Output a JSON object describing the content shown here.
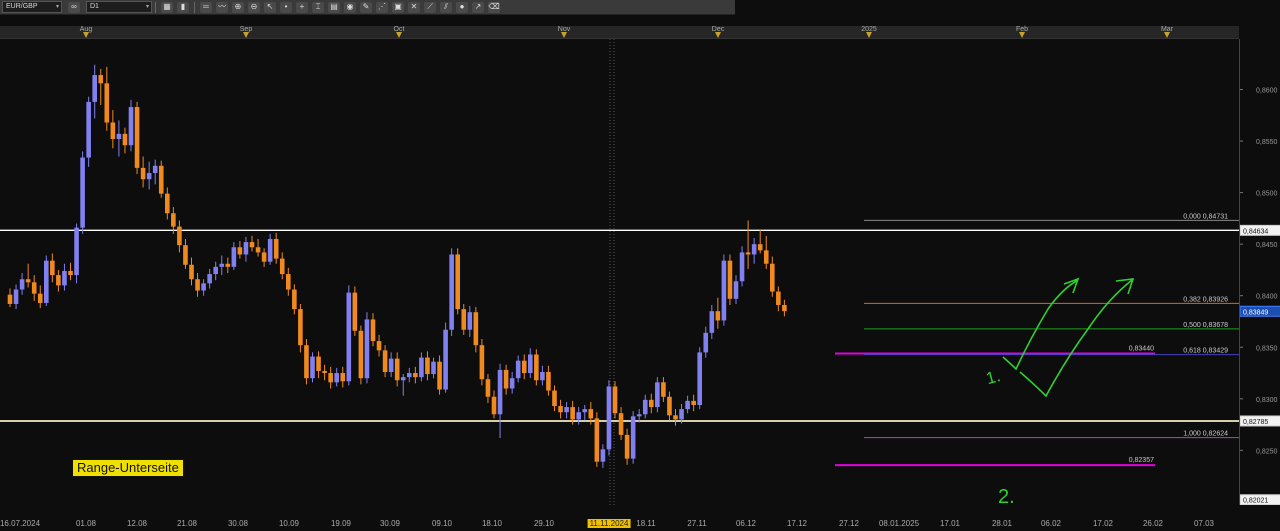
{
  "toolbar": {
    "symbol": "EUR/GBP",
    "timeframe": "D1",
    "buttons": [
      "link-icon",
      "chart-type-icon",
      "bar-icon",
      "line-icon",
      "indicator-icon",
      "zoom-in-icon",
      "zoom-out-icon",
      "crosshair-icon",
      "cursor-icon",
      "dot-icon",
      "plus-icon",
      "cross-icon",
      "trendline-icon",
      "pencil-icon",
      "pattern-icon",
      "fib-icon",
      "shape-icon",
      "text-icon",
      "eraser-icon"
    ]
  },
  "time_axis_top": {
    "months": [
      {
        "label": "Aug",
        "x_date": "01.08.2024"
      },
      {
        "label": "Sep",
        "x_date": "02.09.2024"
      },
      {
        "label": "Oct",
        "x_date": "01.10.2024"
      },
      {
        "label": "Nov",
        "x_date": "01.11.2024"
      },
      {
        "label": "Dec",
        "x_date": "02.12.2024"
      },
      {
        "label": "2025",
        "x_date": "01.01.2025"
      },
      {
        "label": "Feb",
        "x_date": "03.02.2025"
      },
      {
        "label": "Mar",
        "x_date": "03.03.2025"
      }
    ]
  },
  "date_axis": {
    "labels": [
      "16.07.2024",
      "01.08",
      "12.08",
      "21.08",
      "30.08",
      "10.09",
      "19.09",
      "30.09",
      "09.10",
      "18.10",
      "29.10",
      "11.11.2024",
      "18.11",
      "27.11",
      "06.12",
      "17.12",
      "27.12",
      "08.01.2025",
      "17.01",
      "28.01",
      "06.02",
      "17.02",
      "26.02",
      "07.03"
    ],
    "highlighted": "11.11.2024"
  },
  "price_axis": {
    "ticks": [
      "0,8600",
      "0,8550",
      "0,8500",
      "0,8450",
      "0,8400",
      "0,8350",
      "0,8300",
      "0,8250"
    ],
    "tags": [
      {
        "label": "0,84634",
        "value": 0.84634,
        "style": "white"
      },
      {
        "label": "0,83849",
        "value": 0.83849,
        "style": "blue"
      },
      {
        "label": "0,82785",
        "value": 0.82785,
        "style": "white"
      },
      {
        "label": "0,82021",
        "value": 0.82021,
        "style": "white"
      }
    ]
  },
  "annotations": {
    "range_label": "Range-Unterseite",
    "wave_label_1": "1.",
    "wave_label_2": "2.",
    "level_upper": "0,83440",
    "level_lower": "0,82357",
    "fib_levels": [
      {
        "label": "0,000 0,84731",
        "value": 0.84731
      },
      {
        "label": "0,382 0,83926",
        "value": 0.83926
      },
      {
        "label": "0,500 0,83678",
        "value": 0.83678
      },
      {
        "label": "0,618 0,83429",
        "value": 0.83429
      },
      {
        "label": "1,000 0,82624",
        "value": 0.82624
      }
    ],
    "horizontal_lines": [
      {
        "value": 0.84634,
        "color": "#ffffff"
      },
      {
        "value": 0.82785,
        "color": "#f0eac0"
      },
      {
        "value": 0.8344,
        "color": "#e000e0"
      },
      {
        "value": 0.82357,
        "color": "#e000e0"
      }
    ]
  },
  "colors": {
    "bull": "#8080f0",
    "bear": "#f08a1e",
    "background": "#0d0d0d",
    "fib_0": "#888888",
    "fib_382": "#e86020",
    "fib_500": "#20a020",
    "fib_618": "#4040c0",
    "fib_1000": "#a050a0",
    "arrow": "#30d030"
  },
  "chart_data": {
    "type": "candlestick",
    "symbol": "EUR/GBP",
    "timeframe": "D1",
    "ylim": [
      0.8197,
      0.8649
    ],
    "candles": [
      [
        0.8401,
        0.8407,
        0.8389,
        0.8392
      ],
      [
        0.8392,
        0.8411,
        0.8387,
        0.8406
      ],
      [
        0.8406,
        0.8422,
        0.8401,
        0.8416
      ],
      [
        0.8416,
        0.8431,
        0.8408,
        0.8413
      ],
      [
        0.8413,
        0.842,
        0.8395,
        0.8402
      ],
      [
        0.8402,
        0.841,
        0.8388,
        0.8393
      ],
      [
        0.8393,
        0.8439,
        0.839,
        0.8434
      ],
      [
        0.8434,
        0.8441,
        0.8413,
        0.842
      ],
      [
        0.842,
        0.8425,
        0.8404,
        0.841
      ],
      [
        0.841,
        0.8431,
        0.8405,
        0.8424
      ],
      [
        0.8424,
        0.8432,
        0.8415,
        0.842
      ],
      [
        0.842,
        0.847,
        0.8412,
        0.8466
      ],
      [
        0.8466,
        0.854,
        0.846,
        0.8534
      ],
      [
        0.8534,
        0.8593,
        0.8525,
        0.8588
      ],
      [
        0.8588,
        0.8624,
        0.8572,
        0.8614
      ],
      [
        0.8614,
        0.862,
        0.8585,
        0.8606
      ],
      [
        0.8606,
        0.8622,
        0.856,
        0.8568
      ],
      [
        0.8568,
        0.858,
        0.8543,
        0.8552
      ],
      [
        0.8552,
        0.857,
        0.8535,
        0.8557
      ],
      [
        0.8557,
        0.8563,
        0.8538,
        0.8546
      ],
      [
        0.8546,
        0.859,
        0.854,
        0.8583
      ],
      [
        0.8583,
        0.8588,
        0.8518,
        0.8524
      ],
      [
        0.8524,
        0.8535,
        0.8505,
        0.8513
      ],
      [
        0.8513,
        0.853,
        0.8503,
        0.8519
      ],
      [
        0.8519,
        0.8532,
        0.8508,
        0.8526
      ],
      [
        0.8526,
        0.8531,
        0.8495,
        0.8499
      ],
      [
        0.8499,
        0.8505,
        0.8474,
        0.848
      ],
      [
        0.848,
        0.8486,
        0.846,
        0.8467
      ],
      [
        0.8467,
        0.8473,
        0.8442,
        0.8449
      ],
      [
        0.8449,
        0.8455,
        0.8426,
        0.843
      ],
      [
        0.843,
        0.8437,
        0.841,
        0.8416
      ],
      [
        0.8416,
        0.8422,
        0.8399,
        0.8405
      ],
      [
        0.8405,
        0.8416,
        0.84,
        0.8412
      ],
      [
        0.8412,
        0.8426,
        0.8407,
        0.8421
      ],
      [
        0.8421,
        0.8433,
        0.8415,
        0.8428
      ],
      [
        0.8428,
        0.8439,
        0.842,
        0.8431
      ],
      [
        0.8431,
        0.8437,
        0.8422,
        0.8428
      ],
      [
        0.8428,
        0.8452,
        0.8425,
        0.8447
      ],
      [
        0.8447,
        0.8453,
        0.8436,
        0.844
      ],
      [
        0.844,
        0.8457,
        0.8433,
        0.8452
      ],
      [
        0.8452,
        0.8458,
        0.8443,
        0.8447
      ],
      [
        0.8447,
        0.8455,
        0.8438,
        0.8442
      ],
      [
        0.8442,
        0.8446,
        0.8428,
        0.8433
      ],
      [
        0.8433,
        0.846,
        0.843,
        0.8455
      ],
      [
        0.8455,
        0.8461,
        0.8431,
        0.8436
      ],
      [
        0.8436,
        0.8442,
        0.8416,
        0.8421
      ],
      [
        0.8421,
        0.8427,
        0.84,
        0.8406
      ],
      [
        0.8406,
        0.8411,
        0.8382,
        0.8387
      ],
      [
        0.8387,
        0.8392,
        0.8345,
        0.8352
      ],
      [
        0.8352,
        0.8358,
        0.8314,
        0.832
      ],
      [
        0.832,
        0.8345,
        0.8316,
        0.8341
      ],
      [
        0.8341,
        0.8346,
        0.832,
        0.8327
      ],
      [
        0.8327,
        0.8333,
        0.8318,
        0.8325
      ],
      [
        0.8325,
        0.8331,
        0.831,
        0.8316
      ],
      [
        0.8316,
        0.833,
        0.8312,
        0.8325
      ],
      [
        0.8325,
        0.8331,
        0.8311,
        0.8317
      ],
      [
        0.8317,
        0.841,
        0.8313,
        0.8403
      ],
      [
        0.8403,
        0.8409,
        0.8361,
        0.8366
      ],
      [
        0.8366,
        0.8371,
        0.8314,
        0.832
      ],
      [
        0.832,
        0.8384,
        0.8315,
        0.8377
      ],
      [
        0.8377,
        0.8383,
        0.8351,
        0.8356
      ],
      [
        0.8356,
        0.8362,
        0.8341,
        0.8347
      ],
      [
        0.8347,
        0.8352,
        0.8321,
        0.8326
      ],
      [
        0.8326,
        0.8345,
        0.8321,
        0.8339
      ],
      [
        0.8339,
        0.8345,
        0.8312,
        0.8318
      ],
      [
        0.8318,
        0.8324,
        0.8303,
        0.8321
      ],
      [
        0.8321,
        0.833,
        0.8316,
        0.8325
      ],
      [
        0.8325,
        0.8331,
        0.8315,
        0.8321
      ],
      [
        0.8321,
        0.8345,
        0.8317,
        0.834
      ],
      [
        0.834,
        0.8346,
        0.8318,
        0.8324
      ],
      [
        0.8324,
        0.834,
        0.832,
        0.8336
      ],
      [
        0.8336,
        0.8342,
        0.8304,
        0.8309
      ],
      [
        0.8309,
        0.8374,
        0.8306,
        0.8367
      ],
      [
        0.8367,
        0.8446,
        0.8361,
        0.844
      ],
      [
        0.844,
        0.8446,
        0.8382,
        0.8387
      ],
      [
        0.8387,
        0.8392,
        0.8362,
        0.8367
      ],
      [
        0.8367,
        0.839,
        0.836,
        0.8384
      ],
      [
        0.8384,
        0.8389,
        0.8345,
        0.8352
      ],
      [
        0.8352,
        0.8358,
        0.8313,
        0.8319
      ],
      [
        0.8319,
        0.8324,
        0.8296,
        0.8302
      ],
      [
        0.8302,
        0.8308,
        0.8281,
        0.8285
      ],
      [
        0.8285,
        0.8334,
        0.8262,
        0.8328
      ],
      [
        0.8328,
        0.8333,
        0.8304,
        0.831
      ],
      [
        0.831,
        0.8326,
        0.8305,
        0.832
      ],
      [
        0.832,
        0.8342,
        0.8316,
        0.8337
      ],
      [
        0.8337,
        0.8343,
        0.8319,
        0.8325
      ],
      [
        0.8325,
        0.8349,
        0.832,
        0.8343
      ],
      [
        0.8343,
        0.8348,
        0.8313,
        0.8318
      ],
      [
        0.8318,
        0.8332,
        0.8313,
        0.8326
      ],
      [
        0.8326,
        0.8332,
        0.8303,
        0.8308
      ],
      [
        0.8308,
        0.8313,
        0.8288,
        0.8293
      ],
      [
        0.8293,
        0.8299,
        0.8281,
        0.8287
      ],
      [
        0.8287,
        0.8297,
        0.8281,
        0.8292
      ],
      [
        0.8292,
        0.8298,
        0.8275,
        0.828
      ],
      [
        0.828,
        0.8292,
        0.8275,
        0.8287
      ],
      [
        0.8287,
        0.8294,
        0.8279,
        0.829
      ],
      [
        0.829,
        0.8297,
        0.8275,
        0.8281
      ],
      [
        0.8281,
        0.8287,
        0.8234,
        0.8239
      ],
      [
        0.8239,
        0.8256,
        0.8233,
        0.8251
      ],
      [
        0.8251,
        0.8318,
        0.8245,
        0.8312
      ],
      [
        0.8312,
        0.8317,
        0.8281,
        0.8286
      ],
      [
        0.8286,
        0.8292,
        0.826,
        0.8265
      ],
      [
        0.8265,
        0.8271,
        0.8236,
        0.8242
      ],
      [
        0.8242,
        0.8288,
        0.8237,
        0.8283
      ],
      [
        0.8283,
        0.829,
        0.8277,
        0.8285
      ],
      [
        0.8285,
        0.8304,
        0.8281,
        0.8299
      ],
      [
        0.8299,
        0.8305,
        0.8286,
        0.8292
      ],
      [
        0.8292,
        0.8321,
        0.8287,
        0.8316
      ],
      [
        0.8316,
        0.8321,
        0.8297,
        0.8302
      ],
      [
        0.8302,
        0.8307,
        0.8279,
        0.8284
      ],
      [
        0.8284,
        0.829,
        0.8274,
        0.828
      ],
      [
        0.828,
        0.8295,
        0.8276,
        0.829
      ],
      [
        0.829,
        0.8303,
        0.8286,
        0.8298
      ],
      [
        0.8298,
        0.8304,
        0.8288,
        0.8294
      ],
      [
        0.8294,
        0.835,
        0.829,
        0.8345
      ],
      [
        0.8345,
        0.837,
        0.834,
        0.8364
      ],
      [
        0.8364,
        0.8391,
        0.8358,
        0.8385
      ],
      [
        0.8385,
        0.8398,
        0.8368,
        0.8376
      ],
      [
        0.8376,
        0.844,
        0.8371,
        0.8434
      ],
      [
        0.8434,
        0.844,
        0.8391,
        0.8397
      ],
      [
        0.8397,
        0.842,
        0.8392,
        0.8414
      ],
      [
        0.8414,
        0.8448,
        0.8409,
        0.8442
      ],
      [
        0.8442,
        0.8473,
        0.8426,
        0.844
      ],
      [
        0.844,
        0.8456,
        0.8431,
        0.845
      ],
      [
        0.845,
        0.8464,
        0.8441,
        0.8444
      ],
      [
        0.8444,
        0.8458,
        0.8426,
        0.8431
      ],
      [
        0.8431,
        0.8438,
        0.8399,
        0.8404
      ],
      [
        0.8404,
        0.8409,
        0.8385,
        0.8391
      ],
      [
        0.8391,
        0.8396,
        0.838,
        0.8385
      ]
    ]
  }
}
